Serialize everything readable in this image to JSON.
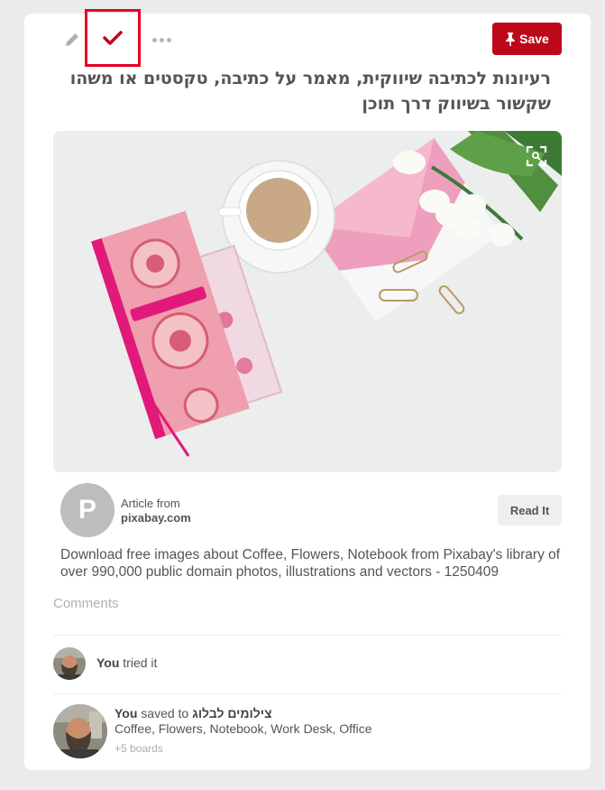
{
  "toolbar": {
    "edit_icon": "pencil-icon",
    "tried_icon": "checkmark-icon",
    "more_icon": "ellipsis-icon",
    "save_label": "Save",
    "save_icon": "pushpin-icon"
  },
  "pin": {
    "title": "רעיונות לכתיבה שיווקית, מאמר על כתיבה, טקסטים או משהו שקשור בשיווק דרך תוכן",
    "zoom_icon": "zoom-icon",
    "source": {
      "avatar_letter": "P",
      "label": "Article from",
      "domain": "pixabay.com",
      "read_label": "Read It"
    },
    "description": "Download free images about Coffee, Flowers, Notebook from Pixabay's library of over 990,000 public domain photos, illustrations and vectors - 1250409"
  },
  "comments_label": "Comments",
  "activity": {
    "tried": {
      "user": "You",
      "text": "tried it"
    },
    "saved": {
      "user": "You",
      "text": "saved to",
      "board": "צילומים לבלוג",
      "tags": "Coffee, Flowers, Notebook, Work Desk, Office",
      "more": "+5 boards"
    }
  },
  "colors": {
    "accent": "#e60023",
    "save": "#bd081c",
    "background": "#ebebeb"
  }
}
